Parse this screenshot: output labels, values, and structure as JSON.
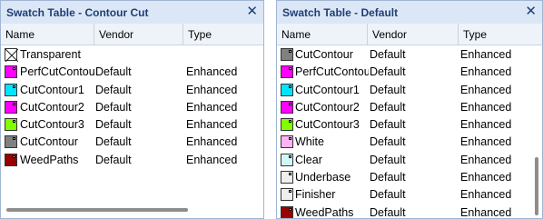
{
  "left_panel": {
    "title": "Swatch Table - Contour Cut",
    "close_glyph": "✕",
    "columns": [
      "Name",
      "Vendor",
      "Type"
    ],
    "rows": [
      {
        "name": "Transparent",
        "vendor": "",
        "type": "",
        "color": "transparent"
      },
      {
        "name": "PerfCutContour",
        "vendor": "Default",
        "type": "Enhanced",
        "color": "#ff00ff"
      },
      {
        "name": "CutContour1",
        "vendor": "Default",
        "type": "Enhanced",
        "color": "#00e5ff"
      },
      {
        "name": "CutContour2",
        "vendor": "Default",
        "type": "Enhanced",
        "color": "#ff00ff"
      },
      {
        "name": "CutContour3",
        "vendor": "Default",
        "type": "Enhanced",
        "color": "#80ff00"
      },
      {
        "name": "CutContour",
        "vendor": "Default",
        "type": "Enhanced",
        "color": "#808080"
      },
      {
        "name": "WeedPaths",
        "vendor": "Default",
        "type": "Enhanced",
        "color": "#990000"
      }
    ]
  },
  "right_panel": {
    "title": "Swatch Table - Default",
    "close_glyph": "✕",
    "columns": [
      "Name",
      "Vendor",
      "Type"
    ],
    "rows": [
      {
        "name": "CutContour",
        "vendor": "Default",
        "type": "Enhanced",
        "color": "#808080"
      },
      {
        "name": "PerfCutContour",
        "vendor": "Default",
        "type": "Enhanced",
        "color": "#ff00ff"
      },
      {
        "name": "CutContour1",
        "vendor": "Default",
        "type": "Enhanced",
        "color": "#00e5ff"
      },
      {
        "name": "CutContour2",
        "vendor": "Default",
        "type": "Enhanced",
        "color": "#ff00ff"
      },
      {
        "name": "CutContour3",
        "vendor": "Default",
        "type": "Enhanced",
        "color": "#80ff00"
      },
      {
        "name": "White",
        "vendor": "Default",
        "type": "Enhanced",
        "color": "#ffb3f5"
      },
      {
        "name": "Clear",
        "vendor": "Default",
        "type": "Enhanced",
        "color": "#cff7f7"
      },
      {
        "name": "Underbase",
        "vendor": "Default",
        "type": "Enhanced",
        "color": "#eeeeee"
      },
      {
        "name": "Finisher",
        "vendor": "Default",
        "type": "Enhanced",
        "color": "#eeeeee"
      },
      {
        "name": "WeedPaths",
        "vendor": "Default",
        "type": "Enhanced",
        "color": "#990000"
      }
    ]
  }
}
